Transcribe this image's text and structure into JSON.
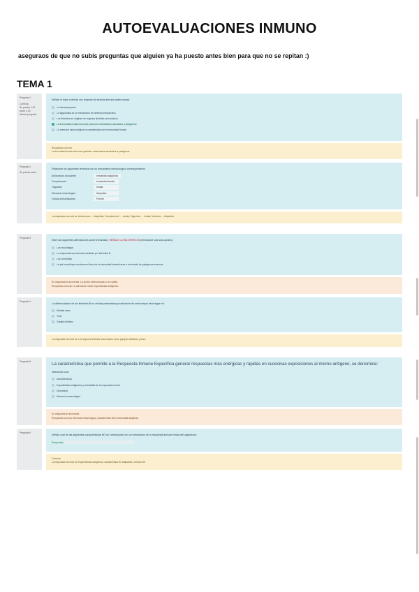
{
  "title": "AUTOEVALUACIONES INMUNO",
  "intro": "aseguraos de que no subís preguntas que alguien ya ha puesto antes bien para que no se repitan :)",
  "tema": "TEMA 1",
  "q1": {
    "label_top": "Pregunta 1",
    "label_mid": "Correcta",
    "label_bot": "Se puntúa 1,00 sobre 1,00",
    "label_flag": "Marcar pregunta",
    "qtext": "Señale la frase correcta con respecto al sistema inmune (seleccionar):",
    "opts": [
      "La hematopoyesis",
      "La fagocitosis es un mecanismo de defensa inespecífico",
      "Los linfocitos se originan en órganos linfoides secundarios",
      "La inmunidad innata reconoce patrones moleculares asociados a patógenos",
      "La memoria inmunológica es característica de la inmunidad innata"
    ],
    "ans_title": "Respuesta correcta",
    "ans_text": "La inmunidad innata reconoce patrones moleculares asociados a patógenos"
  },
  "q2": {
    "label_top": "Pregunta 2",
    "label_bot": "Se puntúa sobre",
    "qtext": "Relacione los siguientes términos con su mecanismo inmunológico correspondiente:",
    "rows": [
      {
        "l": "Anticuerpos circulantes",
        "r": "Inmunidad adquirida"
      },
      {
        "l": "Complemento",
        "r": "Inmunidad innata"
      },
      {
        "l": "Fagocitos",
        "r": "Innata"
      },
      {
        "l": "Memoria inmunológica",
        "r": "Adquirida"
      },
      {
        "l": "Células presentadoras",
        "r": "Puente"
      }
    ],
    "ans_text": "La respuesta correcta es: Anticuerpos → Adquirida; Complemento → Innata; Fagocitos → Innata; Memoria → Adquirida"
  },
  "q3": {
    "label_top": "Pregunta 3",
    "qtext_pre": "Entre las siguientes afirmaciones sobre inmunidad,",
    "qtext_hi": "SEÑALE LA INCORRECTA",
    "qtext_post": "(seleccione una sola opción):",
    "opt1": "Los macrófagos",
    "opt2": "La respuesta humoral está mediada por linfocitos B",
    "opt3": "Los neutrófilos",
    "opt4": "La piel constituye una barrera física de la inmunidad innata frente a la entrada de patógenos externos",
    "ans_title": "Su respuesta es incorrecta. La opción seleccionada no es válida.",
    "ans_text": "Respuesta correcta: La afirmación sobre especificidad antigénica"
  },
  "q4": {
    "label_top": "Pregunta 4",
    "qtext": "La diferenciación de los linfocitos B en células plasmáticas productoras de anticuerpos tiene lugar en:",
    "opt1": "Médula ósea",
    "opt2": "Timo",
    "opt3": "Ganglio linfático",
    "ans_text": "La respuesta correcta es: Los órganos linfoides secundarios como ganglios linfáticos y bazo"
  },
  "q5": {
    "label_top": "Pregunta 5",
    "qtext": "La característica que permite a la Respuesta Inmune Específica generar respuestas más enérgicas y rápidas en sucesivas exposiciones al mismo antígeno, se denomina:",
    "sub": "seleccione una:",
    "opt1": "Autotolerancia",
    "opt2": "Especificidad antigénica y clonalidad de la respuesta inmune",
    "opt3": "Diversidad",
    "opt4": "Memoria inmunológica",
    "ans_title": "Su respuesta es incorrecta.",
    "ans_text": "Respuesta correcta: Memoria inmunológica, característica de la inmunidad adquirida"
  },
  "q6": {
    "label_top": "Pregunta 6",
    "qtext": "Señale cuál de las siguientes características NO se corresponde con un mecanismo de la respuesta inmune innata del organismo:",
    "fill_label": "Respuesta:",
    "ans_title": "Correcta",
    "ans_text": "La respuesta correcta es: Especificidad antigénica; característica RI adaptativa; memoria RI"
  }
}
